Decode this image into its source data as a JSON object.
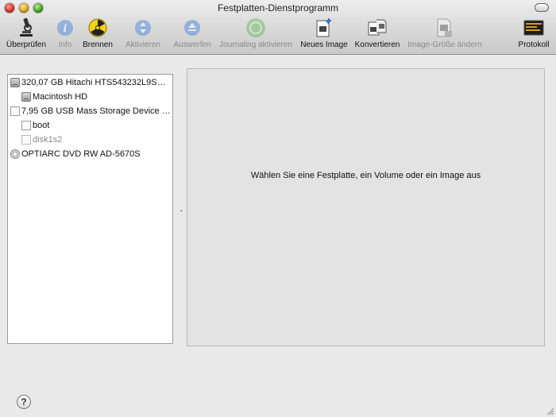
{
  "window": {
    "title": "Festplatten-Dienstprogramm"
  },
  "toolbar": {
    "items": [
      {
        "label": "Überprüfen",
        "icon": "microscope-icon",
        "enabled": true
      },
      {
        "label": "Info",
        "icon": "info-icon",
        "enabled": false
      },
      {
        "label": "Brennen",
        "icon": "burn-icon",
        "enabled": true
      },
      {
        "label": "Aktivieren",
        "icon": "mount-icon",
        "enabled": false
      },
      {
        "label": "Auswerfen",
        "icon": "eject-icon",
        "enabled": false
      },
      {
        "label": "Journaling aktivieren",
        "icon": "journaling-icon",
        "enabled": false
      },
      {
        "label": "Neues Image",
        "icon": "new-image-icon",
        "enabled": true
      },
      {
        "label": "Konvertieren",
        "icon": "convert-icon",
        "enabled": true
      },
      {
        "label": "Image-Größe ändern",
        "icon": "resize-image-icon",
        "enabled": false
      },
      {
        "label": "Protokoll",
        "icon": "log-icon",
        "enabled": true
      }
    ]
  },
  "sidebar": {
    "items": [
      {
        "label": "320,07 GB Hitachi HTS543232L9S…",
        "type": "disk"
      },
      {
        "label": "Macintosh HD",
        "type": "volume"
      },
      {
        "label": "7,95 GB USB Mass Storage Device …",
        "type": "disk"
      },
      {
        "label": "boot",
        "type": "volume"
      },
      {
        "label": "disk1s2",
        "type": "volume-unmounted"
      },
      {
        "label": "OPTIARC DVD RW AD-5670S",
        "type": "optical"
      }
    ]
  },
  "detail": {
    "message": "Wählen Sie eine Festplatte, ein Volume oder ein Image aus"
  },
  "help": {
    "label": "?"
  },
  "colors": {
    "info_blue": "#3d7fd8",
    "burn_yellow": "#f4d21b",
    "journaling_green": "#5fb35a"
  }
}
